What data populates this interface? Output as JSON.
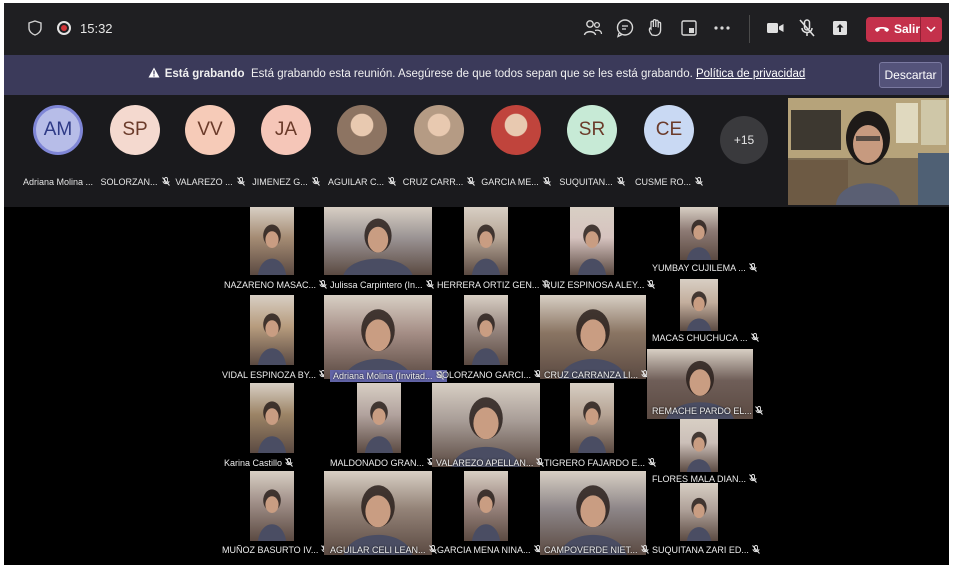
{
  "topbar": {
    "time": "15:32",
    "icons": [
      "shield-icon",
      "recording-icon",
      "participants-icon",
      "chat-icon",
      "raise-hand-icon",
      "share-tray-icon",
      "more-icon",
      "camera-icon",
      "mic-off-icon",
      "share-icon"
    ],
    "leave_label": "Salir"
  },
  "banner": {
    "bold_text": "Está grabando",
    "text": "Está grabando esta reunión. Asegúrese de que todos sepan que se les está grabando.",
    "link": "Política de privacidad",
    "dismiss_label": "Descartar"
  },
  "participants": [
    {
      "initials": "AM",
      "name": "Adriana Molina ...",
      "color": "#b7bde8"
    },
    {
      "initials": "SP",
      "name": "SOLORZAN...",
      "color": "#f4d9cf"
    },
    {
      "initials": "VV",
      "name": "VALAREZO ...",
      "color": "#f6cbb8"
    },
    {
      "initials": "JA",
      "name": "JIMENEZ G...",
      "color": "#f5c6b8"
    },
    {
      "initials": "",
      "name": "AGUILAR C...",
      "color": "#8d7462"
    },
    {
      "initials": "",
      "name": "CRUZ CARR...",
      "color": "#b59b84"
    },
    {
      "initials": "",
      "name": "GARCIA ME...",
      "color": "#c0443c"
    },
    {
      "initials": "SR",
      "name": "SUQUITAN...",
      "color": "#c7ead6"
    },
    {
      "initials": "CE",
      "name": "CUSME RO...",
      "color": "#c9d9f3"
    }
  ],
  "overflow_count": "+15",
  "gallery": [
    {
      "name": "NAZARENO MASAC...",
      "color": "#a58c74"
    },
    {
      "name": "Julissa Carpintero (In...",
      "color": "#9b9494"
    },
    {
      "name": "HERRERA ORTIZ GEN...",
      "color": "#b5a596"
    },
    {
      "name": "RUIZ ESPINOSA ALEY...",
      "color": "#d6c3bf"
    },
    {
      "name": "YUMBAY CUJILEMA ...",
      "color": "#8d7a74"
    },
    {
      "name": "MACAS CHUCHUCA ...",
      "color": "#c3ae9d"
    },
    {
      "name": "VIDAL ESPINOZA BY...",
      "color": "#b79c7e"
    },
    {
      "name": "Adriana Molina (Invitad...",
      "color": "#a58e86"
    },
    {
      "name": "SOLORZANO GARCI...",
      "color": "#9b8b84"
    },
    {
      "name": "CRUZ CARRANZA LI...",
      "color": "#8a7563"
    },
    {
      "name": "REMACHE PARDO EL...",
      "color": "#6f5e58"
    },
    {
      "name": "Karina Castillo",
      "color": "#9c8466"
    },
    {
      "name": "MALDONADO GRAN...",
      "color": "#b2a39e"
    },
    {
      "name": "VALAREZO APELLAN...",
      "color": "#a89d97"
    },
    {
      "name": "TIGRERO FAJARDO E...",
      "color": "#b5a394"
    },
    {
      "name": "FLORES MALA DIAN...",
      "color": "#cbbfb8"
    },
    {
      "name": "MUÑOZ BASURTO IV...",
      "color": "#a08f88"
    },
    {
      "name": "AGUILAR CELI LEAN...",
      "color": "#948378"
    },
    {
      "name": "GARCIA MENA NINA...",
      "color": "#9f8a83"
    },
    {
      "name": "CAMPOVERDE NIET...",
      "color": "#8d8688"
    },
    {
      "name": "SUQUITANA ZARI ED...",
      "color": "#b0a29a"
    }
  ]
}
